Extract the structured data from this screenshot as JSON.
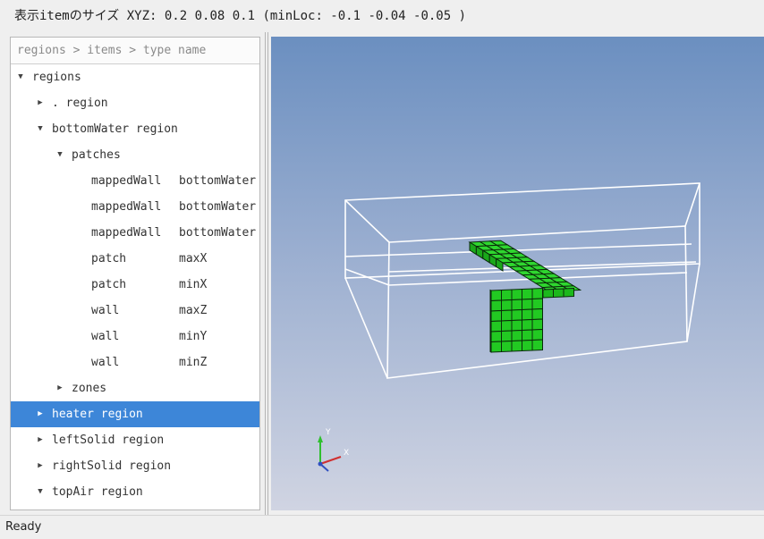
{
  "info_bar": "表示itemのサイズ XYZ: 0.2 0.08 0.1  (minLoc: -0.1 -0.04 -0.05 )",
  "tree": {
    "header": "regions > items > type name",
    "rows": [
      {
        "label": "regions",
        "col1": "",
        "col2": "",
        "arrow": "▼",
        "indent": 0
      },
      {
        "label": ". region",
        "col1": "",
        "col2": "",
        "arrow": "▶",
        "indent": 1
      },
      {
        "label": "bottomWater region",
        "col1": "",
        "col2": "",
        "arrow": "▼",
        "indent": 1
      },
      {
        "label": "patches",
        "col1": "",
        "col2": "",
        "arrow": "▼",
        "indent": 2
      },
      {
        "label": "",
        "col1": "mappedWall",
        "col2": "bottomWater",
        "arrow": "",
        "indent": 3
      },
      {
        "label": "",
        "col1": "mappedWall",
        "col2": "bottomWater",
        "arrow": "",
        "indent": 3
      },
      {
        "label": "",
        "col1": "mappedWall",
        "col2": "bottomWater",
        "arrow": "",
        "indent": 3
      },
      {
        "label": "",
        "col1": "patch",
        "col2": "maxX",
        "arrow": "",
        "indent": 3
      },
      {
        "label": "",
        "col1": "patch",
        "col2": "minX",
        "arrow": "",
        "indent": 3
      },
      {
        "label": "",
        "col1": "wall",
        "col2": "maxZ",
        "arrow": "",
        "indent": 3
      },
      {
        "label": "",
        "col1": "wall",
        "col2": "minY",
        "arrow": "",
        "indent": 3
      },
      {
        "label": "",
        "col1": "wall",
        "col2": "minZ",
        "arrow": "",
        "indent": 3
      },
      {
        "label": "zones",
        "col1": "",
        "col2": "",
        "arrow": "▶",
        "indent": 2
      },
      {
        "label": "heater region",
        "col1": "",
        "col2": "",
        "arrow": "▶",
        "indent": 1,
        "selected": true
      },
      {
        "label": "leftSolid region",
        "col1": "",
        "col2": "",
        "arrow": "▶",
        "indent": 1
      },
      {
        "label": "rightSolid region",
        "col1": "",
        "col2": "",
        "arrow": "▶",
        "indent": 1
      },
      {
        "label": "topAir region",
        "col1": "",
        "col2": "",
        "arrow": "▼",
        "indent": 1
      }
    ]
  },
  "axes": {
    "x": "X",
    "y": "Y"
  },
  "colors": {
    "selection": "#3d86d8",
    "mesh_fill": "#22cc22",
    "mesh_edge": "#0a2a0a",
    "wireframe": "#ffffff",
    "axis_x": "#d03030",
    "axis_y": "#2fbf2f",
    "axis_z": "#3050c0"
  },
  "status": "Ready"
}
